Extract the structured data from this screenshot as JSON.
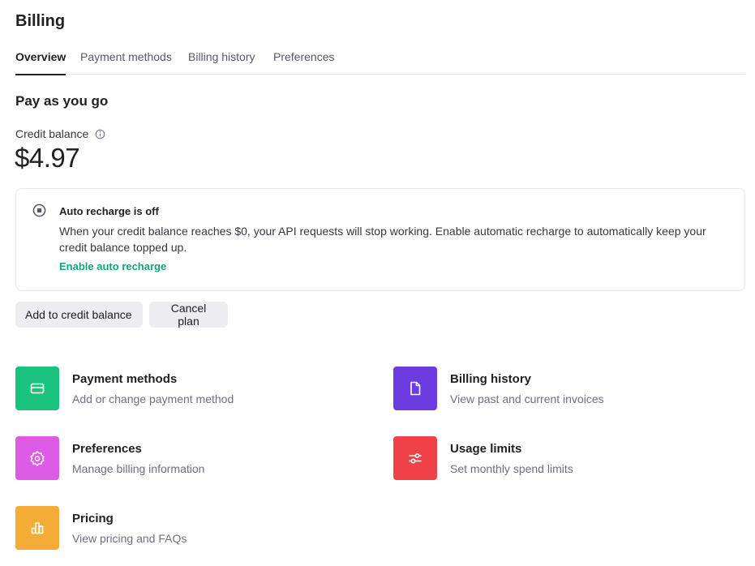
{
  "page": {
    "title": "Billing"
  },
  "tabs": [
    {
      "label": "Overview",
      "active": true
    },
    {
      "label": "Payment methods",
      "active": false
    },
    {
      "label": "Billing history",
      "active": false
    },
    {
      "label": "Preferences",
      "active": false
    }
  ],
  "plan": {
    "title": "Pay as you go",
    "credit_label": "Credit balance",
    "credit_amount": "$4.97"
  },
  "notice": {
    "title": "Auto recharge is off",
    "body": "When your credit balance reaches $0, your API requests will stop working. Enable automatic recharge to automatically keep your credit balance topped up.",
    "link": "Enable auto recharge"
  },
  "buttons": {
    "add_credit": "Add to credit balance",
    "cancel_plan": "Cancel plan"
  },
  "cards": {
    "payment": {
      "title": "Payment methods",
      "subtitle": "Add or change payment method",
      "icon": "credit-card-icon",
      "color": "#19c37d"
    },
    "history": {
      "title": "Billing history",
      "subtitle": "View past and current invoices",
      "icon": "document-icon",
      "color": "#6c3ce0"
    },
    "prefs": {
      "title": "Preferences",
      "subtitle": "Manage billing information",
      "icon": "gear-icon",
      "color": "#dd5ce5"
    },
    "limits": {
      "title": "Usage limits",
      "subtitle": "Set monthly spend limits",
      "icon": "sliders-icon",
      "color": "#ef4146"
    },
    "pricing": {
      "title": "Pricing",
      "subtitle": "View pricing and FAQs",
      "icon": "chart-icon",
      "color": "#f4ac36"
    }
  },
  "colors": {
    "accent": "#10a37f",
    "text": "#202123",
    "muted": "#6e6e80",
    "button_bg": "#ececf1"
  }
}
